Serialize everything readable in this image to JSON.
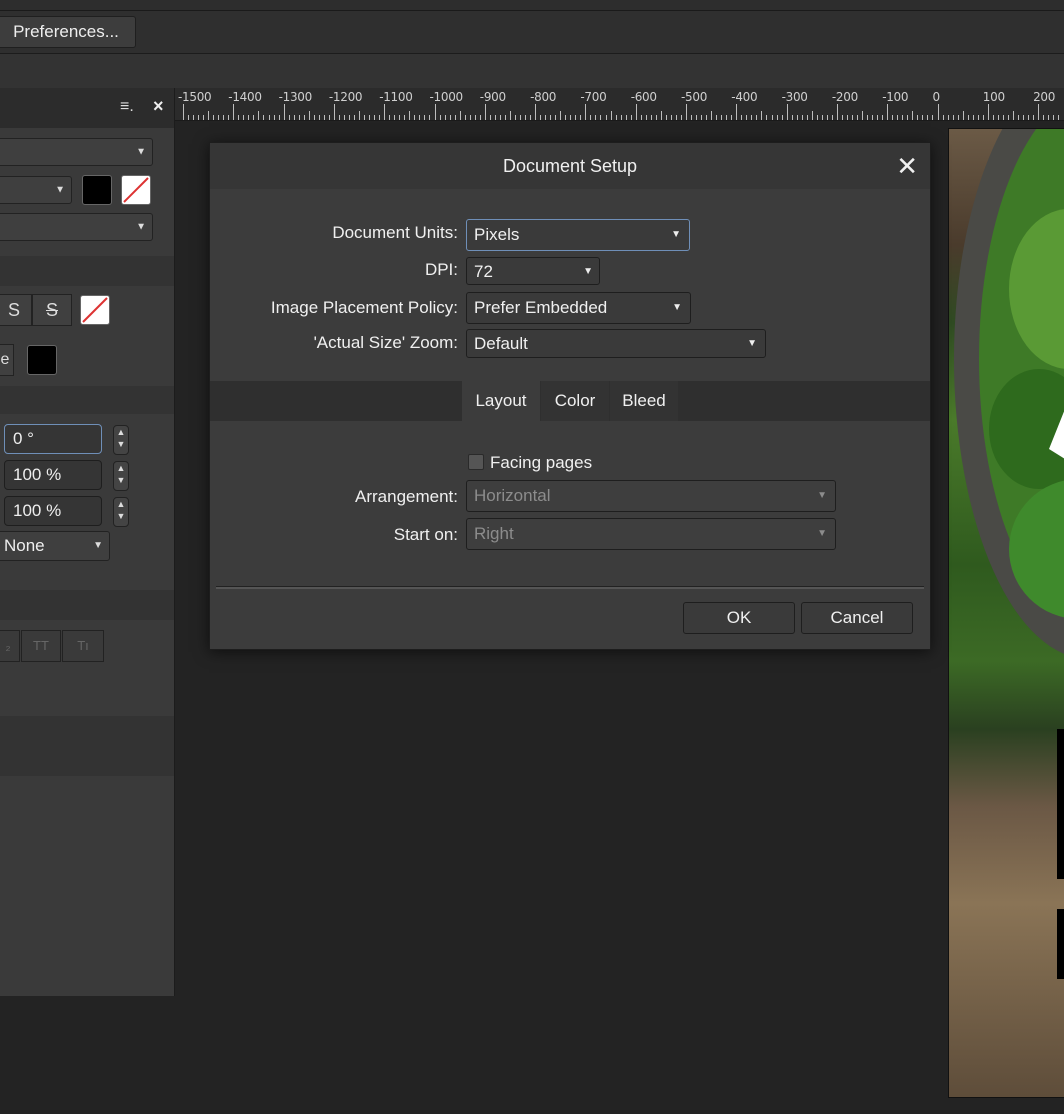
{
  "toolbar": {
    "preferences_label": "Preferences..."
  },
  "ruler": {
    "labels": [
      "-1500",
      "-1400",
      "-1300",
      "-1200",
      "-1100",
      "-1000",
      "-900",
      "-800",
      "-700",
      "-600",
      "-500",
      "-400",
      "-300",
      "-200",
      "-100",
      "0",
      "100",
      "200"
    ]
  },
  "left_panel": {
    "menu_icon": "≡.",
    "close_icon": "×",
    "strike_s": "S",
    "strike_s2": "S",
    "partial_e": "e",
    "rotation": "0 °",
    "scale_x": "100 %",
    "scale_y": "100 %",
    "none_value": "None",
    "t_btn1": "₂",
    "t_btn2": "TT",
    "t_btn3": "Tı"
  },
  "dialog": {
    "title": "Document Setup",
    "close": "✕",
    "document_units_label": "Document Units:",
    "document_units_value": "Pixels",
    "dpi_label": "DPI:",
    "dpi_value": "72",
    "image_policy_label": "Image Placement Policy:",
    "image_policy_value": "Prefer Embedded",
    "actual_size_label": "'Actual Size' Zoom:",
    "actual_size_value": "Default",
    "tabs": [
      "Layout",
      "Color",
      "Bleed"
    ],
    "facing_pages_label": "Facing pages",
    "arrangement_label": "Arrangement:",
    "arrangement_value": "Horizontal",
    "start_on_label": "Start on:",
    "start_on_value": "Right",
    "ok": "OK",
    "cancel": "Cancel"
  },
  "icons": {
    "dropdown": "chevron-down-icon"
  },
  "colors": {
    "accent_focus": "#6f8fb8",
    "dialog_bg": "#3c3c3c"
  }
}
